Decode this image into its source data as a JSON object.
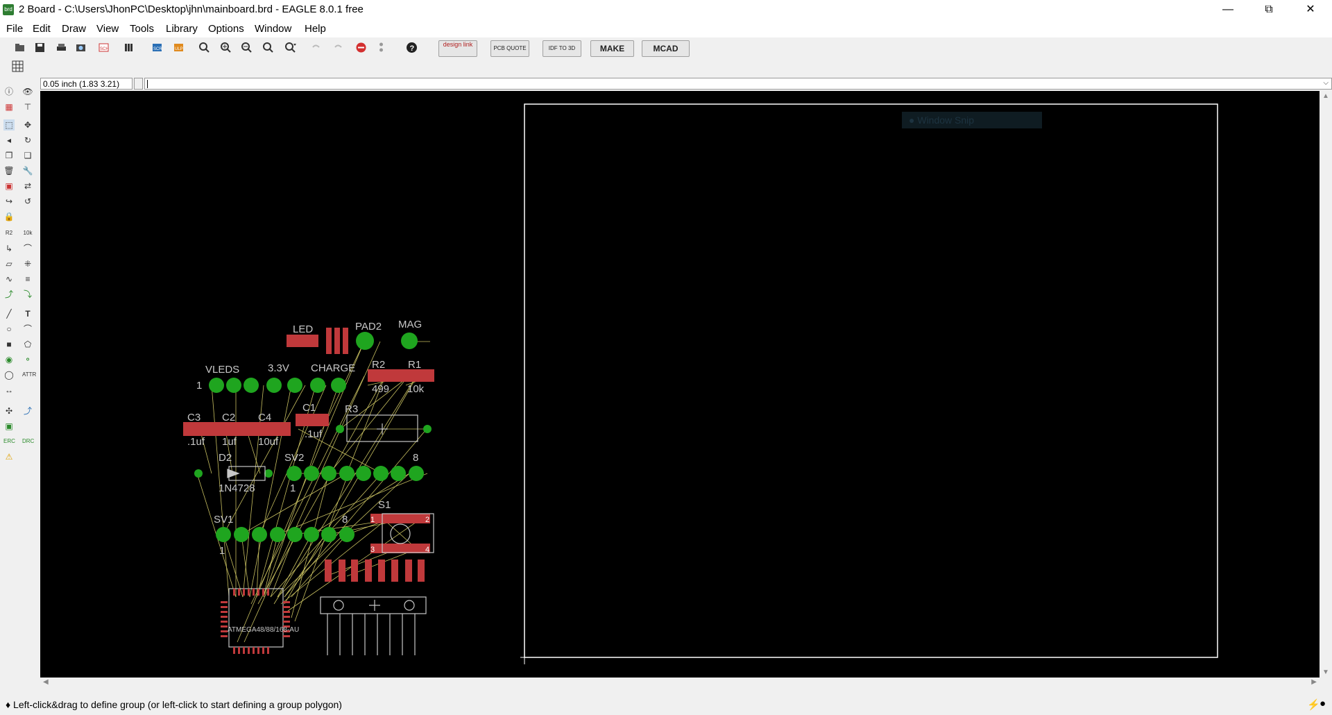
{
  "window": {
    "title": "2 Board - C:\\Users\\JhonPC\\Desktop\\jhn\\mainboard.brd - EAGLE 8.0.1 free",
    "app_icon": "eagle-board-icon",
    "controls": {
      "minimize": "—",
      "restore": "⧉",
      "close": "✕"
    }
  },
  "menu": [
    "File",
    "Edit",
    "Draw",
    "View",
    "Tools",
    "Library",
    "Options",
    "Window",
    "Help"
  ],
  "toolbar": {
    "icons": [
      "open-icon",
      "save-icon",
      "print-icon",
      "cam-icon",
      "sch-icon",
      "library-icon",
      "script-icon",
      "ulp-icon",
      "zoom-fit-icon",
      "zoom-in-icon",
      "zoom-out-icon",
      "zoom-select-icon",
      "zoom-area-icon",
      "undo-icon",
      "redo-icon",
      "stop-icon",
      "go-icon",
      "help-icon"
    ],
    "ext_buttons": {
      "design_link": "design link",
      "pcb_quote": "PCB QUOTE",
      "idf": "IDF TO 3D",
      "make": "MAKE",
      "mcad": "MCAD"
    }
  },
  "command": {
    "grid_readout": "0.05 inch (1.83 3.21)",
    "input_value": ""
  },
  "tooltip": "Window Snip",
  "status": {
    "message": "Left-click&drag to define group (or left-click to start defining a group polygon)"
  },
  "board": {
    "labels": {
      "led": "LED",
      "pad2": "PAD2",
      "mag": "MAG",
      "vleds": "VLEDS",
      "v33": "3.3V",
      "charge": "CHARGE",
      "r2": "R2",
      "r2_val": "499",
      "r1": "R1",
      "r1_val": "10k",
      "c3": "C3",
      "c3_val": ".1uf",
      "c2": "C2",
      "c2_val": "1uf",
      "c4": "C4",
      "c4_val": "10uf",
      "c1": "C1",
      "c1_val": ".1uf",
      "r3": "R3",
      "d2": "D2",
      "d2_val": "1N4728",
      "sv2": "SV2",
      "sv2_pin1": "1",
      "sv2_pin8": "8",
      "sv1": "SV1",
      "sv1_pin1": "1",
      "sv1_pin8": "8",
      "s1": "S1",
      "s1_p1": "1",
      "s1_p2": "2",
      "s1_p3": "3",
      "s1_p4": "4",
      "vleds_pin1": "1",
      "mcu": "ATMEGA48/88/168-AU"
    },
    "colors": {
      "pad": "#1fa51f",
      "smd": "#c0393b",
      "airwire": "#c8c060",
      "outline": "#c8c8c8",
      "board_outline": "#ffffff"
    }
  }
}
